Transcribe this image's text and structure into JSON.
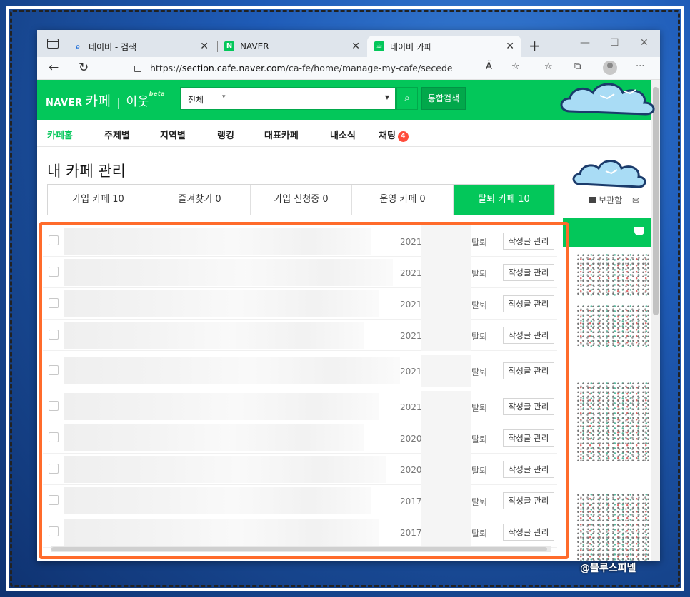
{
  "browser": {
    "tabs": [
      {
        "label": "네이버 - 검색",
        "icon": "search-icon"
      },
      {
        "label": "NAVER",
        "icon": "naver-n-icon"
      },
      {
        "label": "네이버 카페",
        "icon": "naver-cafe-icon",
        "active": true
      }
    ],
    "url_prefix": "https://",
    "url_host": "section.cafe.naver.com",
    "url_path": "/ca-fe/home/manage-my-cafe/secede",
    "reader_label": "Ã"
  },
  "header": {
    "logo_naver": "NAVER",
    "logo_cafe": "카페",
    "logo_neighbor": "이웃",
    "logo_beta": "beta",
    "search_scope": "전체",
    "search_button_label": "통합검색"
  },
  "gnb": {
    "items": [
      "카페홈",
      "주제별",
      "지역별",
      "랭킹",
      "대표카페",
      "내소식",
      "채팅"
    ],
    "chat_badge": "4"
  },
  "main": {
    "title": "내 카페 관리",
    "subtabs": [
      "가입 카페 10",
      "즐겨찾기 0",
      "가입 신청중 0",
      "운영 카페 0",
      "탈퇴 카페 10"
    ]
  },
  "rows": [
    {
      "year": "2021",
      "status": "탈퇴",
      "action": "작성글 관리"
    },
    {
      "year": "2021",
      "status": "탈퇴",
      "action": "작성글 관리"
    },
    {
      "year": "2021",
      "status": "탈퇴",
      "action": "작성글 관리"
    },
    {
      "year": "2021",
      "status": "탈퇴",
      "action": "작성글 관리"
    },
    {
      "year": "2021",
      "status": "탈퇴",
      "action": "작성글 관리"
    },
    {
      "year": "2021",
      "status": "탈퇴",
      "action": "작성글 관리"
    },
    {
      "year": "2020",
      "status": "탈퇴",
      "action": "작성글 관리"
    },
    {
      "year": "2020",
      "status": "탈퇴",
      "action": "작성글 관리"
    },
    {
      "year": "2017",
      "status": "탈퇴",
      "action": "작성글 관리"
    },
    {
      "year": "2017",
      "status": "탈퇴",
      "action": "작성글 관리"
    }
  ],
  "side": {
    "storage_label": "보관함"
  },
  "watermark": "@블루스피넬",
  "colors": {
    "naver_green": "#03c75a",
    "highlight": "#ff6b2b",
    "badge_red": "#ff4c3b"
  }
}
